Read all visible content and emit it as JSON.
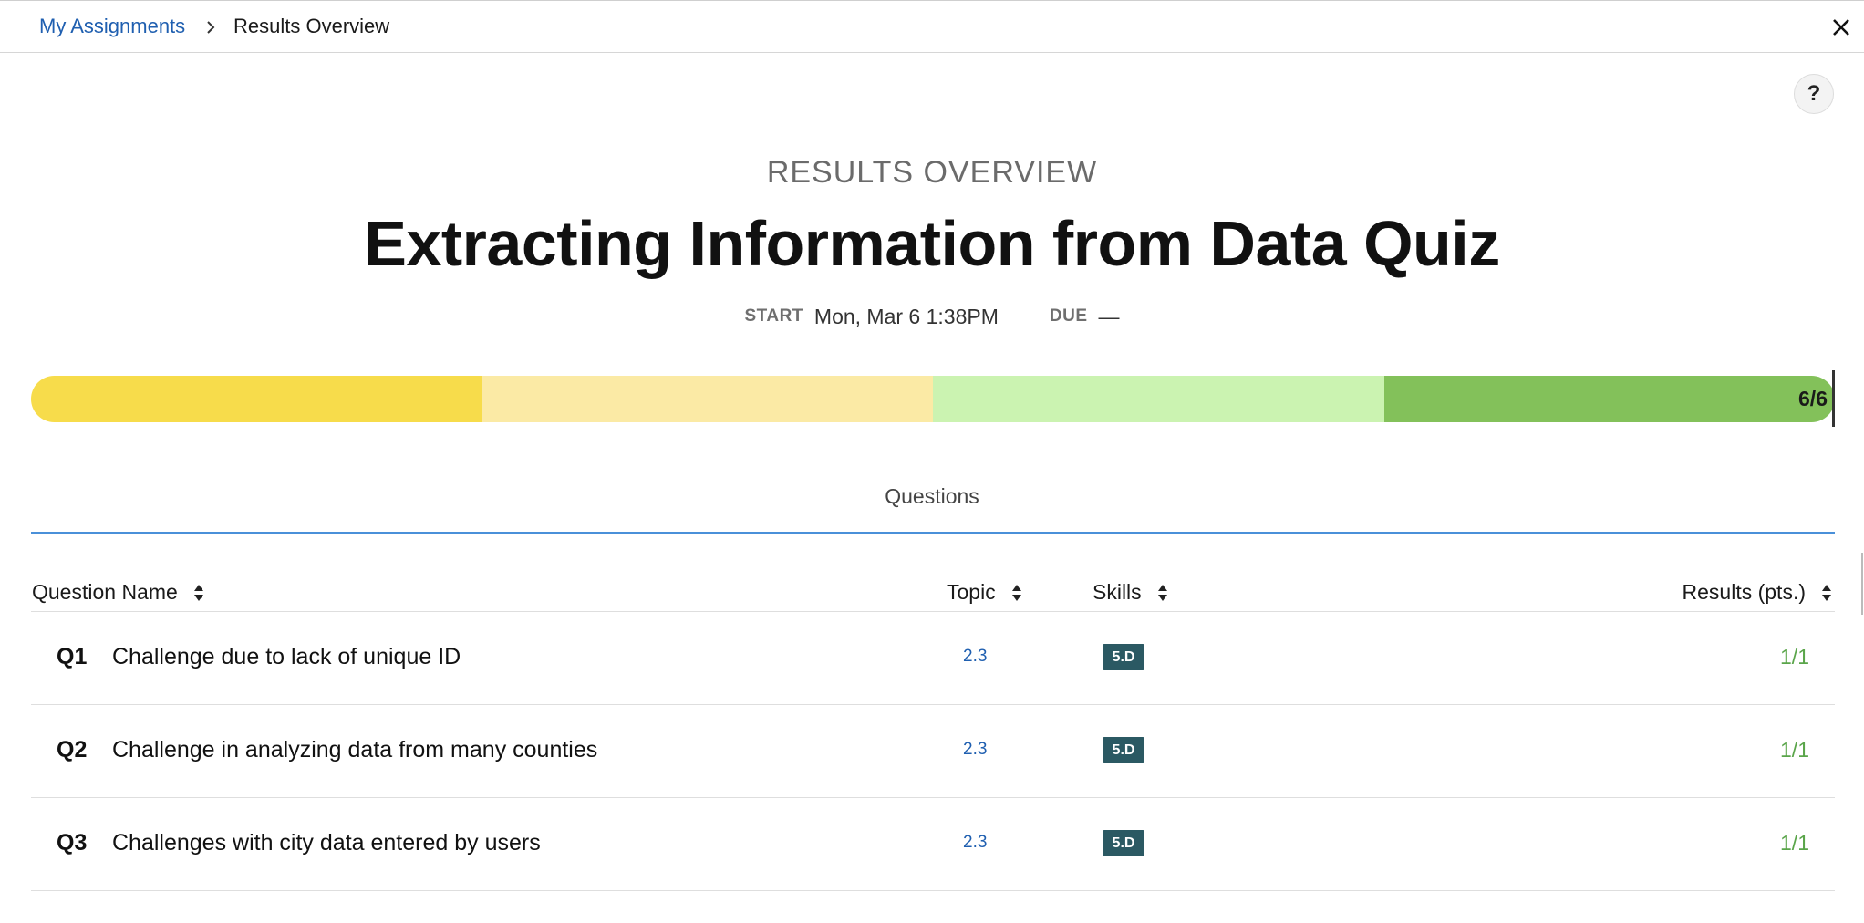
{
  "breadcrumb": {
    "parent": "My Assignments",
    "current": "Results Overview"
  },
  "header": {
    "eyebrow": "RESULTS OVERVIEW",
    "title": "Extracting Information from Data Quiz",
    "start_label": "START",
    "start_value": "Mon, Mar 6 1:38PM",
    "due_label": "DUE",
    "due_value": "—"
  },
  "icons": {
    "close": "close-icon",
    "help": "help-icon",
    "chevron": "chevron-right-icon",
    "sort": "sort-icon"
  },
  "help_label": "?",
  "progress": {
    "label": "6/6",
    "score": 6,
    "total": 6,
    "colors": [
      "#f7dc4b",
      "#fbeaa5",
      "#cbf3b1",
      "#83c15a"
    ]
  },
  "tabs": {
    "questions": "Questions"
  },
  "table": {
    "columns": {
      "name": "Question Name",
      "topic": "Topic",
      "skills": "Skills",
      "results": "Results (pts.)"
    },
    "rows": [
      {
        "num": "Q1",
        "name": "Challenge due to lack of unique ID",
        "topic": "2.3",
        "skill": "5.D",
        "result": "1/1"
      },
      {
        "num": "Q2",
        "name": "Challenge in analyzing data from many counties",
        "topic": "2.3",
        "skill": "5.D",
        "result": "1/1"
      },
      {
        "num": "Q3",
        "name": "Challenges with city data entered by users",
        "topic": "2.3",
        "skill": "5.D",
        "result": "1/1"
      }
    ]
  },
  "colors": {
    "link": "#1f5fb0",
    "skill_badge": "#2b5963",
    "result": "#5aa54a",
    "tab_underline": "#4a90d9"
  }
}
